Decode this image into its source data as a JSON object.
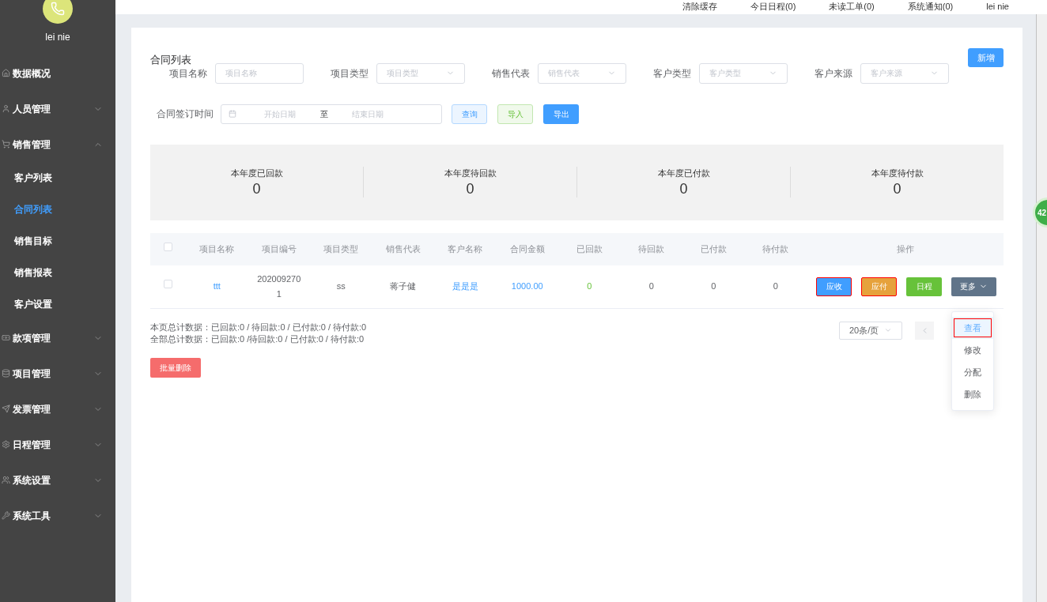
{
  "user": {
    "name": "lei nie"
  },
  "sidebar": {
    "items": [
      {
        "label": "数据概况",
        "selected": false
      },
      {
        "label": "人员管理",
        "expanded": false,
        "selected": false
      },
      {
        "label": "销售管理",
        "expanded": true,
        "selected": false,
        "children": [
          {
            "label": "客户列表",
            "selected": false
          },
          {
            "label": "合同列表",
            "selected": true
          },
          {
            "label": "销售目标",
            "selected": false
          },
          {
            "label": "销售报表",
            "selected": false
          },
          {
            "label": "客户设置",
            "selected": false
          }
        ]
      },
      {
        "label": "款项管理",
        "expanded": false,
        "selected": false
      },
      {
        "label": "项目管理",
        "expanded": false,
        "selected": false
      },
      {
        "label": "发票管理",
        "expanded": false,
        "selected": false
      },
      {
        "label": "日程管理",
        "expanded": false,
        "selected": false
      },
      {
        "label": "系统设置",
        "expanded": false,
        "selected": false
      },
      {
        "label": "系统工具",
        "expanded": false,
        "selected": false
      }
    ]
  },
  "header": {
    "links": [
      "清除缓存",
      "今日日程(0)",
      "未读工单(0)",
      "系统通知(0)"
    ],
    "user": "lei nie"
  },
  "page": {
    "title": "合同列表",
    "add_button": "新增"
  },
  "filters": [
    {
      "label": "项目名称",
      "placeholder": "项目名称",
      "kind": "input"
    },
    {
      "label": "项目类型",
      "placeholder": "项目类型",
      "kind": "select"
    },
    {
      "label": "销售代表",
      "placeholder": "销售代表",
      "kind": "select"
    },
    {
      "label": "客户类型",
      "placeholder": "客户类型",
      "kind": "select"
    },
    {
      "label": "客户来源",
      "placeholder": "客户来源",
      "kind": "select"
    }
  ],
  "date_filter": {
    "label": "合同签订时间",
    "start_placeholder": "开始日期",
    "separator": "至",
    "end_placeholder": "结束日期"
  },
  "actions": [
    {
      "label": "查询",
      "kind": "plain-blue"
    },
    {
      "label": "导入",
      "kind": "plain-green"
    },
    {
      "label": "导出",
      "kind": "primary"
    }
  ],
  "stats": [
    {
      "label": "本年度已回款",
      "value": "0"
    },
    {
      "label": "本年度待回款",
      "value": "0"
    },
    {
      "label": "本年度已付款",
      "value": "0"
    },
    {
      "label": "本年度待付款",
      "value": "0"
    }
  ],
  "table": {
    "all_checked": false,
    "columns": [
      "项目名称",
      "项目编号",
      "项目类型",
      "销售代表",
      "客户名称",
      "合同金额",
      "已回款",
      "待回款",
      "已付款",
      "待付款",
      "操作"
    ],
    "rows": [
      {
        "checked": false,
        "cells": [
          {
            "text": "ttt",
            "kind": "link"
          },
          {
            "text": "2020092701",
            "kind": "text"
          },
          {
            "text": "ss",
            "kind": "text"
          },
          {
            "text": "蒋子健",
            "kind": "text"
          },
          {
            "text": "是是是",
            "kind": "link"
          },
          {
            "text": "1000.00",
            "kind": "link"
          },
          {
            "text": "0",
            "kind": "green"
          },
          {
            "text": "0",
            "kind": "text"
          },
          {
            "text": "0",
            "kind": "text"
          },
          {
            "text": "0",
            "kind": "text"
          }
        ],
        "buttons": [
          {
            "label": "应收",
            "kind": "blue",
            "highlighted": true
          },
          {
            "label": "应付",
            "kind": "orange",
            "highlighted": true
          },
          {
            "label": "日程",
            "kind": "green",
            "highlighted": false
          },
          {
            "label": "更多",
            "kind": "more",
            "highlighted": false
          }
        ]
      }
    ]
  },
  "more_menu": [
    {
      "label": "查看",
      "selected": true,
      "highlighted": true
    },
    {
      "label": "修改",
      "selected": false,
      "highlighted": false
    },
    {
      "label": "分配",
      "selected": false,
      "highlighted": false
    },
    {
      "label": "删除",
      "selected": false,
      "highlighted": false
    }
  ],
  "summary": [
    "本页总计数据：已回款:0 / 待回款:0 / 已付款:0 / 待付款:0",
    "全部总计数据：已回款:0 /待回款:0 / 已付款:0 / 待付款:0"
  ],
  "batch_delete": "批量删除",
  "pagination": {
    "page_size": "20条/页"
  },
  "floating_badge": "42"
}
